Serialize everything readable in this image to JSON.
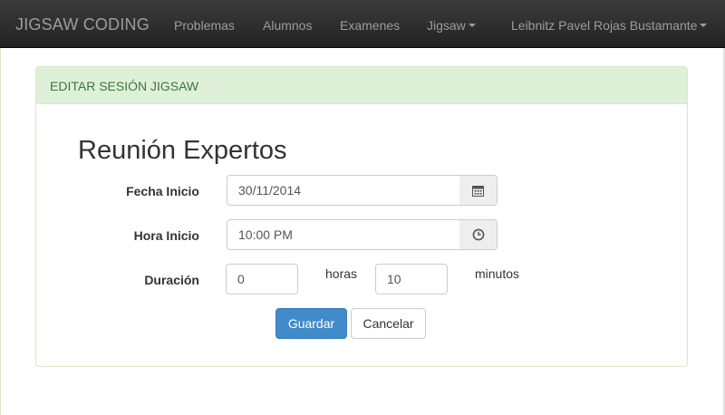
{
  "navbar": {
    "brand": "JIGSAW CODING",
    "items": [
      {
        "label": "Problemas"
      },
      {
        "label": "Alumnos"
      },
      {
        "label": "Examenes"
      },
      {
        "label": "Jigsaw"
      }
    ],
    "user": "Leibnitz Pavel Rojas Bustamante"
  },
  "panel": {
    "heading": "EDITAR SESIÓN JIGSAW",
    "title": "Reunión Expertos"
  },
  "form": {
    "fecha_label": "Fecha Inicio",
    "fecha_value": "30/11/2014",
    "hora_label": "Hora Inicio",
    "hora_value": "10:00 PM",
    "duracion_label": "Duración",
    "horas_value": "0",
    "horas_unit": "horas",
    "minutos_value": "10",
    "minutos_unit": "minutos",
    "save_label": "Guardar",
    "cancel_label": "Cancelar"
  },
  "icons": {
    "calendar": "calendar-icon",
    "clock": "clock-icon",
    "caret": "caret-down-icon"
  },
  "colors": {
    "navbar": "#222222",
    "panel_heading_bg": "#dff0d8",
    "panel_heading_text": "#3c763d",
    "primary": "#428bca"
  }
}
